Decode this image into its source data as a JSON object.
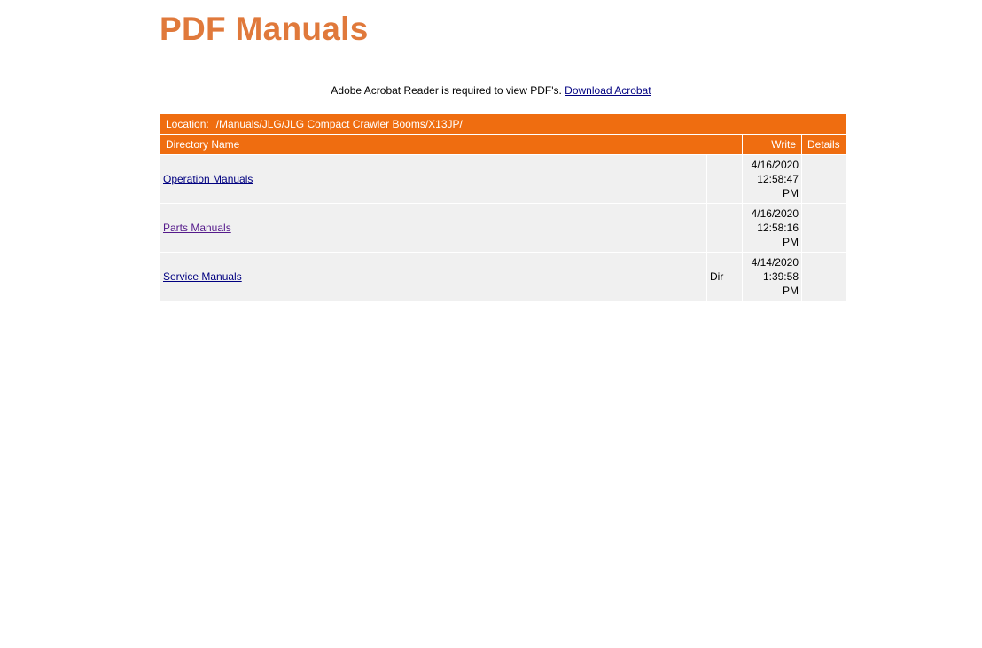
{
  "page": {
    "title": "PDF Manuals"
  },
  "notice": {
    "text": "Adobe Acrobat Reader is required to view PDF's.",
    "link_label": "Download Acrobat"
  },
  "location": {
    "label": "Location:",
    "root_sep": "/",
    "crumbs": [
      "Manuals",
      "JLG",
      "JLG Compact Crawler Booms",
      "X13JP"
    ],
    "sep": "/"
  },
  "table": {
    "headers": {
      "name": "Directory Name",
      "type": "",
      "write": "Write",
      "details": "Details"
    },
    "rows": [
      {
        "name": "Operation Manuals",
        "type": "",
        "write": "4/16/2020 12:58:47 PM",
        "details": "",
        "visited": false
      },
      {
        "name": "Parts Manuals",
        "type": "",
        "write": "4/16/2020 12:58:16 PM",
        "details": "",
        "visited": true
      },
      {
        "name": "Service Manuals",
        "type": "Dir",
        "write": "4/14/2020 1:39:58 PM",
        "details": "",
        "visited": false
      }
    ]
  },
  "colors": {
    "title": "#e0793b",
    "header_bar": "#ef6d10",
    "row_bg": "#f0f0f0",
    "link": "#000080",
    "visited_link": "#551a8b"
  }
}
